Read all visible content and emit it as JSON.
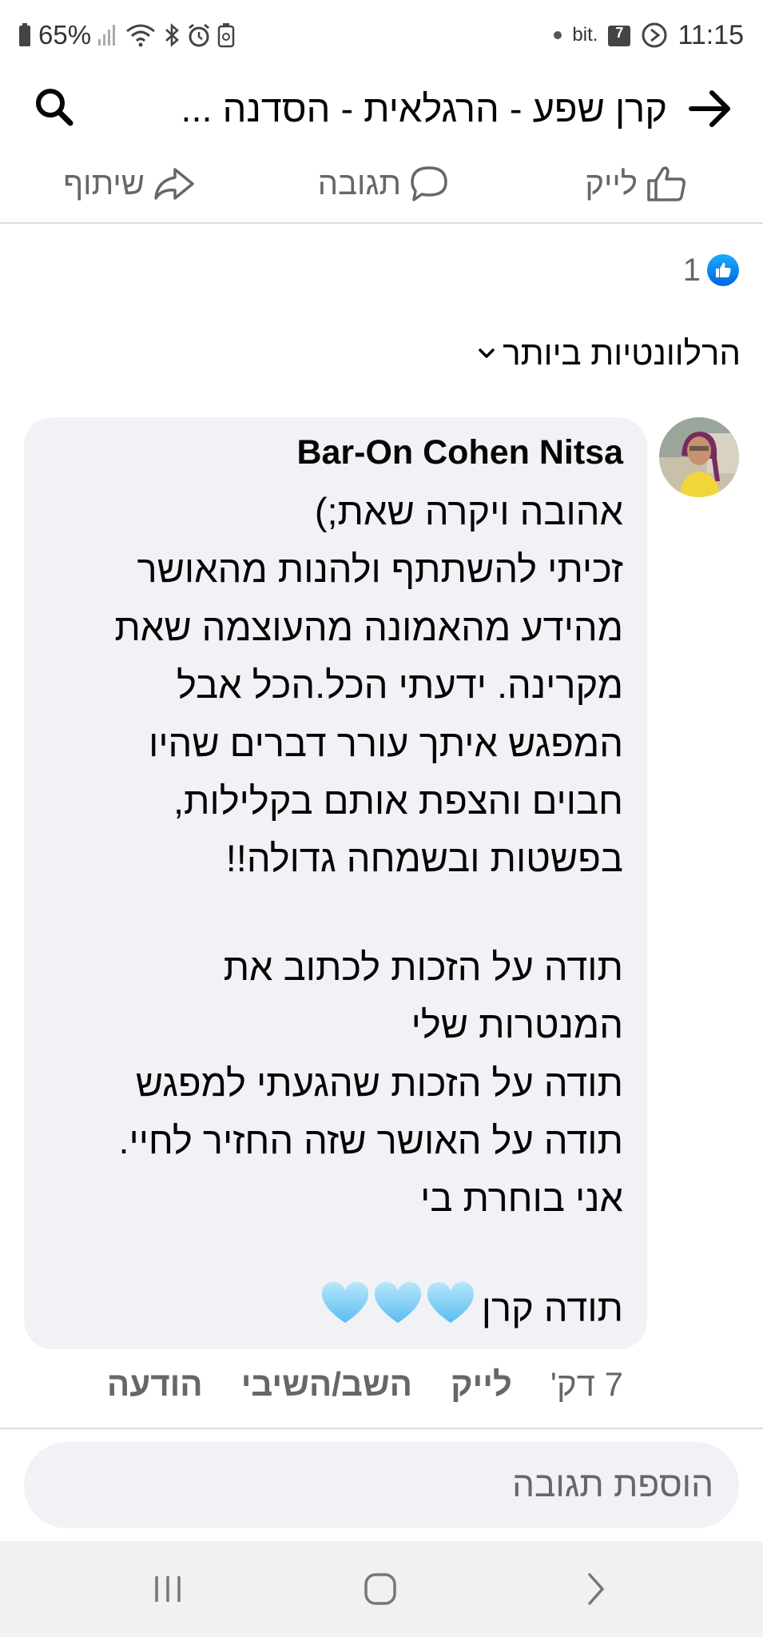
{
  "status_bar": {
    "battery": "65%",
    "time": "11:15",
    "carrier_icon": "bit.",
    "calendar_day": "7"
  },
  "header": {
    "title": "קרן שפע - הרגלאית - הסדנה ..."
  },
  "actions": {
    "like": "לייק",
    "comment": "תגובה",
    "share": "שיתוף"
  },
  "reactions": {
    "count": "1"
  },
  "sort": {
    "label": "הרלוונטיות ביותר"
  },
  "comment": {
    "author": "Bar-On Cohen Nitsa",
    "lines": [
      "אהובה ויקרה שאת;)",
      "זכיתי להשתתף ולהנות מהאושר",
      "מהידע מהאמונה מהעוצמה שאת",
      "מקרינה. ידעתי הכל.הכל אבל",
      "המפגש איתך עורר דברים שהיו",
      "חבוים והצפת אותם בקלילות,",
      "בפשטות ובשמחה גדולה!!",
      "",
      "תודה על הזכות  לכתוב את",
      "המנטרות שלי",
      "תודה על הזכות שהגעתי למפגש",
      "תודה על האושר שזה החזיר לחיי.",
      "אני בוחרת בי",
      "",
      "תודה קרן"
    ],
    "time": "7 דק'",
    "like": "לייק",
    "reply": "השב/השיבי",
    "message": "הודעה"
  },
  "add_comment": {
    "placeholder": "הוספת תגובה"
  },
  "colors": {
    "bubble": "#f0f2f5",
    "like_blue": "#0866ff",
    "heart": "#8fd4f5",
    "secondary_text": "#65676b"
  }
}
